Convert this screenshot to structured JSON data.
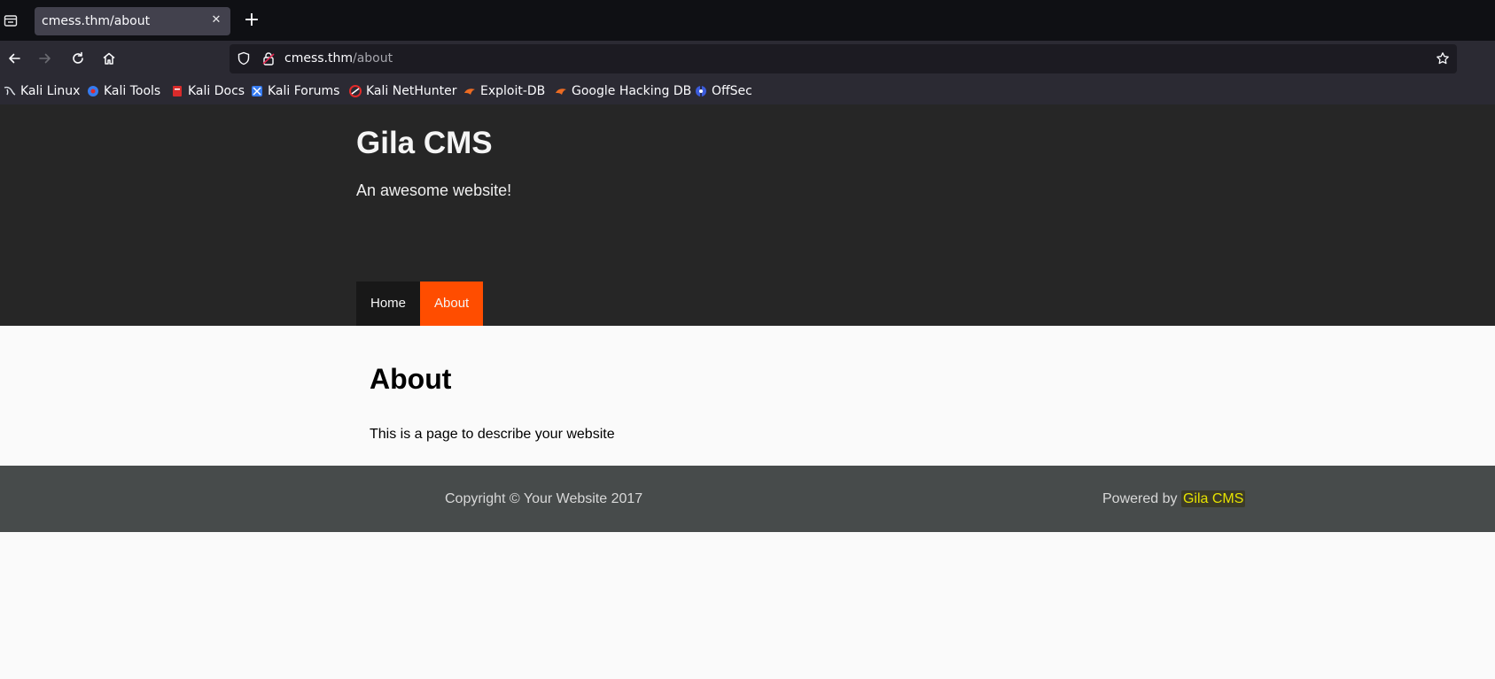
{
  "browser": {
    "tab_title": "cmess.thm/about",
    "url_host": "cmess.thm",
    "url_path": "/about",
    "bookmarks": [
      {
        "label": "Kali Linux",
        "icon": "kali-dragon-icon"
      },
      {
        "label": "Kali Tools",
        "icon": "kali-tools-icon"
      },
      {
        "label": "Kali Docs",
        "icon": "kali-docs-icon"
      },
      {
        "label": "Kali Forums",
        "icon": "kali-forums-icon"
      },
      {
        "label": "Kali NetHunter",
        "icon": "kali-nethunter-icon"
      },
      {
        "label": "Exploit-DB",
        "icon": "exploit-db-icon"
      },
      {
        "label": "Google Hacking DB",
        "icon": "ghdb-icon"
      },
      {
        "label": "OffSec",
        "icon": "offsec-icon"
      }
    ]
  },
  "site": {
    "title": "Gila CMS",
    "tagline": "An awesome website!",
    "menu": [
      {
        "label": "Home",
        "active": false
      },
      {
        "label": "About",
        "active": true
      }
    ],
    "accent_color": "#ff4d00"
  },
  "page": {
    "heading": "About",
    "body": "This is a page to describe your website"
  },
  "footer": {
    "copyright": "Copyright © Your Website 2017",
    "powered_prefix": "Powered by",
    "powered_link": "Gila CMS"
  }
}
